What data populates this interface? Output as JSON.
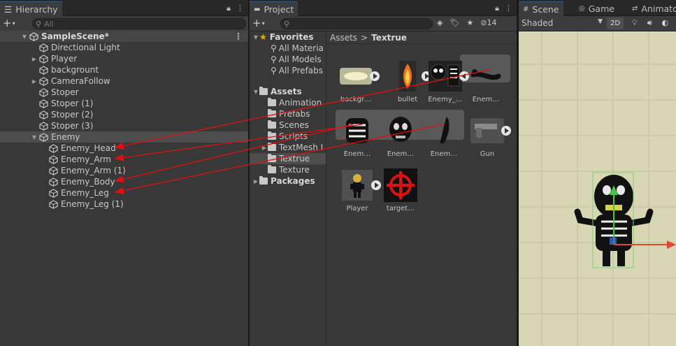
{
  "hierarchy": {
    "tab_label": "Hierarchy",
    "search_placeholder": "All",
    "scene_name": "SampleScene*",
    "items": [
      {
        "label": "Directional Light",
        "expandable": false
      },
      {
        "label": "Player",
        "expandable": true
      },
      {
        "label": "backgrount",
        "expandable": false
      },
      {
        "label": "CameraFollow",
        "expandable": true
      },
      {
        "label": "Stoper",
        "expandable": false
      },
      {
        "label": "Stoper (1)",
        "expandable": false
      },
      {
        "label": "Stoper (2)",
        "expandable": false
      },
      {
        "label": "Stoper (3)",
        "expandable": false
      },
      {
        "label": "Enemy",
        "expandable": true,
        "expanded": true,
        "selected": true
      }
    ],
    "children": [
      "Enemy_Head",
      "Enemy_Arm",
      "Enemy_Arm (1)",
      "Enemy_Body",
      "Enemy_Leg",
      "Enemy_Leg (1)"
    ]
  },
  "project": {
    "tab_label": "Project",
    "hidden_count": "14",
    "favorites_label": "Favorites",
    "favorites": [
      "All Materia",
      "All Models",
      "All Prefabs"
    ],
    "assets_label": "Assets",
    "folders": [
      "Animation",
      "Prefabs",
      "Scenes",
      "Scripts",
      "TextMesh I",
      "Textrue",
      "Texture"
    ],
    "packages_label": "Packages",
    "breadcrumb": {
      "root": "Assets",
      "separator": ">",
      "current": "Textrue"
    },
    "assets": [
      {
        "label": "backgr…"
      },
      {
        "label": "bullet"
      },
      {
        "label": "Enemy_…"
      },
      {
        "label": "Enem…"
      },
      {
        "label": "Enem…"
      },
      {
        "label": "Enem…"
      },
      {
        "label": "Enem…"
      },
      {
        "label": "Gun"
      },
      {
        "label": "Player"
      },
      {
        "label": "target…"
      }
    ]
  },
  "scene": {
    "tabs": [
      "Scene",
      "Game",
      "Animator"
    ],
    "shading": "Shaded",
    "mode_2d": "2D"
  },
  "colors": {
    "accent": "#2c5d87",
    "arrow": "#e01010",
    "scene_bg": "#d9d8b4"
  }
}
